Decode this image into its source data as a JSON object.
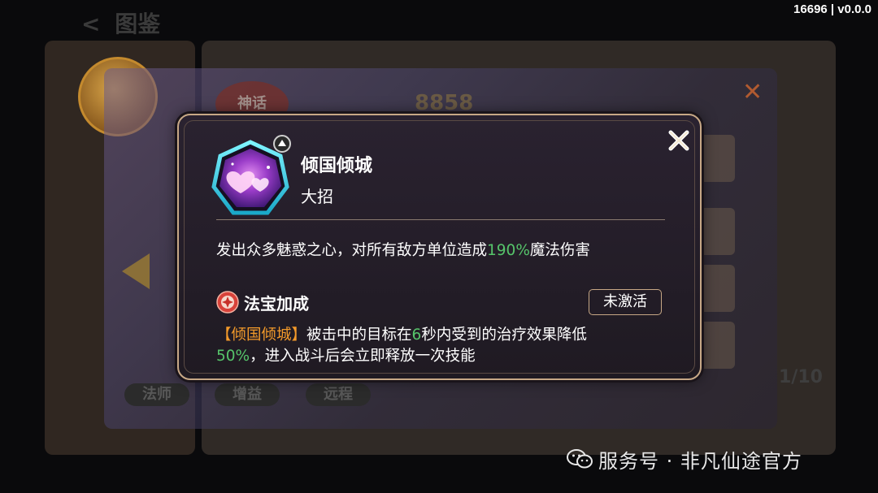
{
  "version": "16696 | v0.0.0",
  "background": {
    "header_title": "图鉴",
    "mythic_tag": "神话",
    "power_value": "8858",
    "tags": [
      "法师",
      "增益",
      "远程"
    ],
    "counter": "1/10"
  },
  "dialog": {
    "skill_name": "倾国倾城",
    "skill_type": "大招",
    "description": {
      "before": "发出众多魅惑之心，对所有敌方单位造成",
      "percent": "190%",
      "after": "魔法伤害"
    },
    "treasure": {
      "title": "法宝加成",
      "status": "未激活",
      "effect": {
        "skill_ref": "【倾国倾城】",
        "text1": "被击中的目标在",
        "seconds": "6",
        "text2": "秒内受到的治疗效果降低",
        "percent": "50%",
        "text3": "，进入战斗后会立即释放一次技能"
      }
    },
    "colors": {
      "accent_green": "#56c46a",
      "accent_orange": "#f39a2a",
      "border": "#c7a886"
    }
  },
  "watermark": {
    "text": "服务号 · 非凡仙途官方"
  }
}
